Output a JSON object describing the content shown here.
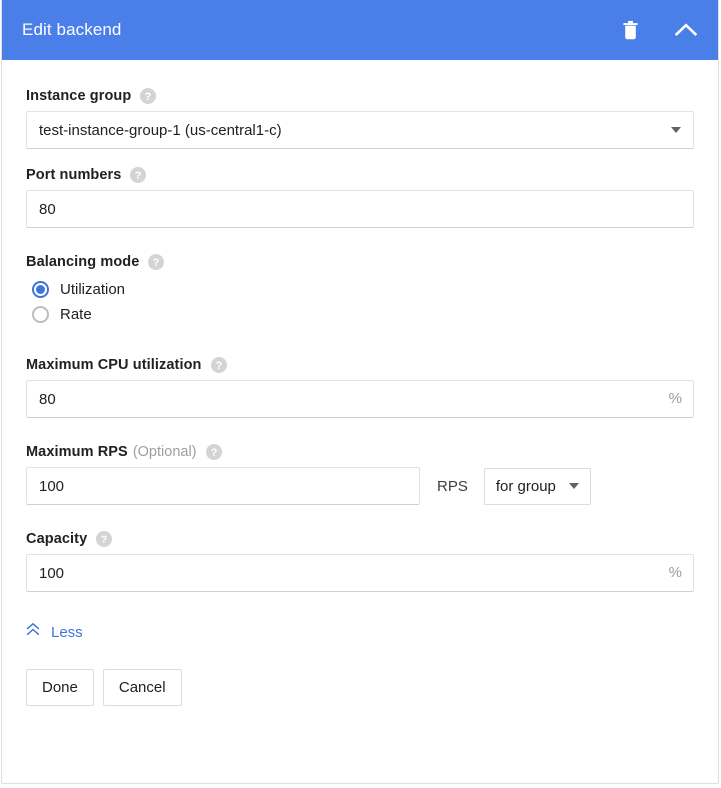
{
  "header": {
    "title": "Edit backend",
    "delete_icon": "trash-icon",
    "collapse_icon": "chevron-up-icon",
    "background_color": "#4a7ee8"
  },
  "form": {
    "instance_group": {
      "label": "Instance group",
      "help_icon": "help-icon",
      "value": "test-instance-group-1 (us-central1-c)"
    },
    "port_numbers": {
      "label": "Port numbers",
      "help_icon": "help-icon",
      "value": "80"
    },
    "balancing_mode": {
      "label": "Balancing mode",
      "help_icon": "help-icon",
      "options": [
        {
          "label": "Utilization",
          "selected": true
        },
        {
          "label": "Rate",
          "selected": false
        }
      ]
    },
    "max_cpu_utilization": {
      "label": "Maximum CPU utilization",
      "help_icon": "help-icon",
      "value": "80",
      "suffix": "%"
    },
    "max_rps": {
      "label": "Maximum RPS",
      "optional_text": "(Optional)",
      "help_icon": "help-icon",
      "value": "100",
      "unit": "RPS",
      "scope_value": "for group"
    },
    "capacity": {
      "label": "Capacity",
      "help_icon": "help-icon",
      "value": "100",
      "suffix": "%"
    }
  },
  "less_toggle": {
    "label": "Less",
    "icon": "double-chevron-up-icon",
    "color": "#3f75d8"
  },
  "actions": {
    "done_label": "Done",
    "cancel_label": "Cancel"
  }
}
